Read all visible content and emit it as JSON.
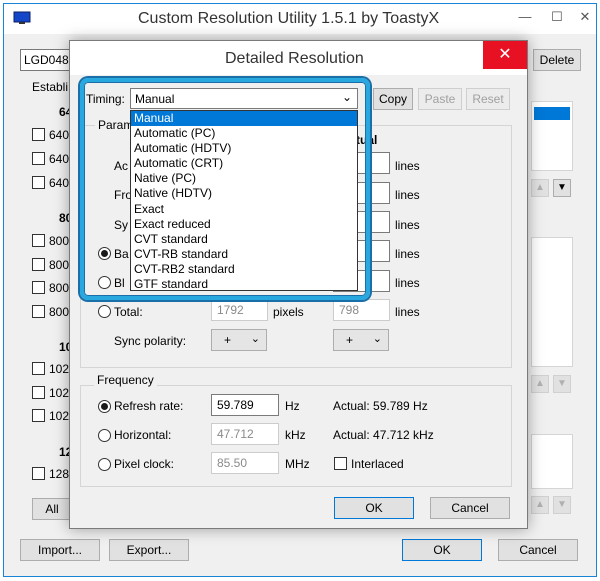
{
  "main_window": {
    "title": "Custom Resolution Utility 1.5.1 by ToastyX",
    "monitor_select": "LGD048",
    "delete_label": "Delete",
    "established_label": "Establi",
    "row_labels": {
      "g1": "64",
      "g2": "80",
      "g3": "10",
      "g4": "12"
    },
    "checkbox_items": [
      "640",
      "640",
      "640",
      "800",
      "800",
      "800",
      "800",
      "102",
      "102",
      "102",
      "128"
    ],
    "all_label": "All",
    "import_label": "Import...",
    "export_label": "Export...",
    "ok_label": "OK",
    "cancel_label": "Cancel"
  },
  "dialog": {
    "title": "Detailed Resolution",
    "timing_label": "Timing:",
    "timing_value": "Manual",
    "copy_label": "Copy",
    "paste_label": "Paste",
    "reset_label": "Reset",
    "params_label": "Param",
    "actual_header": "tual",
    "row_partials": [
      "Ac",
      "Fro",
      "Sy"
    ],
    "back_partial": "Ba",
    "blank_partial": "Bl",
    "units": [
      "lines",
      "lines",
      "lines",
      "lines",
      "lines"
    ],
    "total": {
      "label": "Total:",
      "pixels_value": "1792",
      "pixels_unit": "pixels",
      "lines_value": "798",
      "lines_unit": "lines"
    },
    "sync_polarity": {
      "label": "Sync polarity:",
      "h_value": "+",
      "v_value": "+"
    },
    "frequency": {
      "group_label": "Frequency",
      "refresh_label": "Refresh rate:",
      "refresh_value": "59.789",
      "refresh_unit": "Hz",
      "refresh_actual": "Actual: 59.789 Hz",
      "horizontal_label": "Horizontal:",
      "horizontal_value": "47.712",
      "horizontal_unit": "kHz",
      "horizontal_actual": "Actual: 47.712 kHz",
      "pixel_clock_label": "Pixel clock:",
      "pixel_clock_value": "85.50",
      "pixel_clock_unit": "MHz",
      "interlaced_label": "Interlaced"
    },
    "ok_label": "OK",
    "cancel_label": "Cancel",
    "timing_options": [
      "Manual",
      "Automatic (PC)",
      "Automatic (HDTV)",
      "Automatic (CRT)",
      "Native (PC)",
      "Native (HDTV)",
      "Exact",
      "Exact reduced",
      "CVT standard",
      "CVT-RB standard",
      "CVT-RB2 standard",
      "GTF standard"
    ]
  },
  "colors": {
    "accent": "#0078d7",
    "highlight": "#29a8e0",
    "close_red": "#e81123"
  }
}
